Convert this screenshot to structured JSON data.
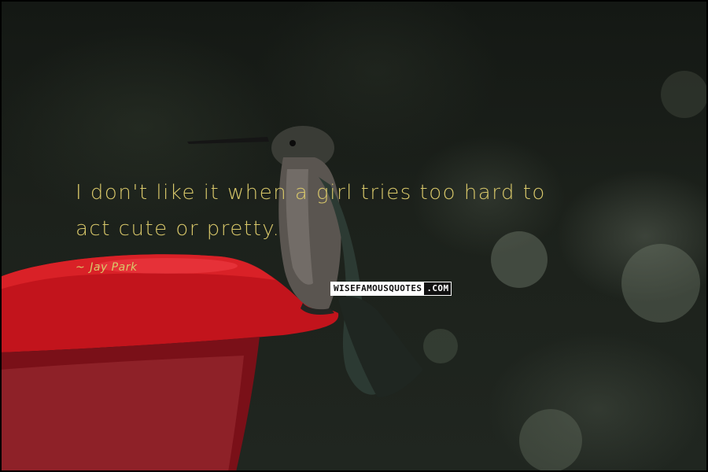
{
  "quote": {
    "line1": "I don't like it when a girl tries too hard to",
    "line2": "act cute or pretty."
  },
  "author": {
    "dash": "~",
    "name": "Jay Park"
  },
  "watermark": {
    "main": "WISEFAMOUSQUOTES",
    "tld": ".COM"
  },
  "colors": {
    "quote_text": "#d9c86a",
    "feeder_red": "#c2141c",
    "background": "#1c211b"
  },
  "photo": {
    "subject": "hummingbird perched on red feeder"
  }
}
